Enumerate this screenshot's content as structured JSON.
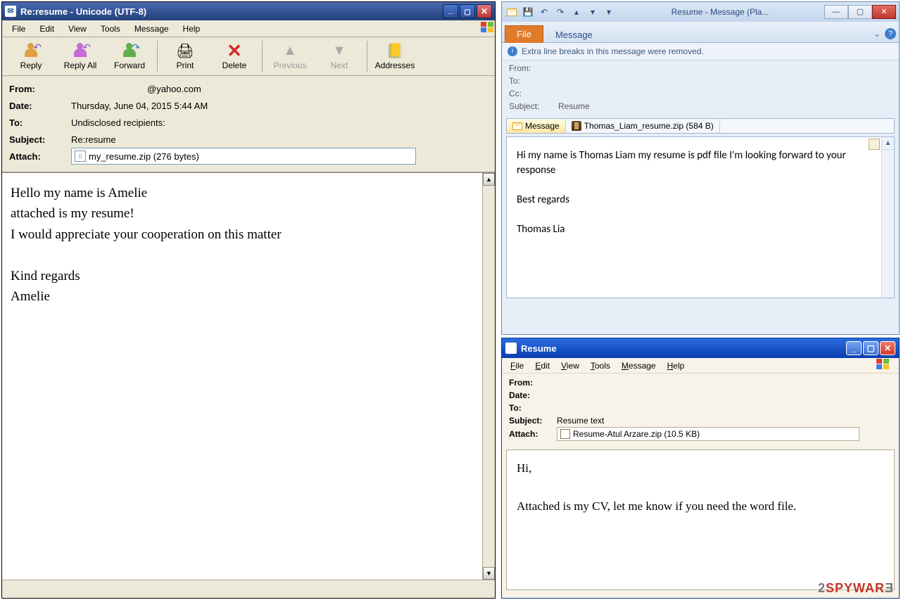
{
  "win1": {
    "title": "Re:resume - Unicode (UTF-8)",
    "menu": [
      "File",
      "Edit",
      "View",
      "Tools",
      "Message",
      "Help"
    ],
    "toolbar": {
      "reply": "Reply",
      "replyall": "Reply All",
      "forward": "Forward",
      "print": "Print",
      "delete": "Delete",
      "previous": "Previous",
      "next": "Next",
      "addresses": "Addresses"
    },
    "headers": {
      "from_lbl": "From:",
      "from": "@yahoo.com",
      "date_lbl": "Date:",
      "date": "Thursday, June 04, 2015 5:44 AM",
      "to_lbl": "To:",
      "to": "Undisclosed recipients:",
      "subj_lbl": "Subject:",
      "subj": "Re:resume",
      "attach_lbl": "Attach:",
      "attach": "my_resume.zip (276 bytes)"
    },
    "body": "Hello my name is Amelie\n attached is my resume!\nI would appreciate your cooperation on this matter\n\nKind regards\nAmelie"
  },
  "win2": {
    "title": "Resume - Message (Pla...",
    "tabs": {
      "file": "File",
      "message": "Message"
    },
    "info": "Extra line breaks in this message were removed.",
    "headers": {
      "from_lbl": "From:",
      "to_lbl": "To:",
      "cc_lbl": "Cc:",
      "subj_lbl": "Subject:",
      "subj": "Resume"
    },
    "attachtabs": {
      "msg": "Message",
      "file": "Thomas_Liam_resume.zip (584 B)"
    },
    "body": "Hi my name is Thomas Liam my resume is pdf file I'm looking forward to your response\n\nBest regards\n\nThomas Lia"
  },
  "win3": {
    "title": "Resume",
    "menu": [
      "File",
      "Edit",
      "View",
      "Tools",
      "Message",
      "Help"
    ],
    "headers": {
      "from_lbl": "From:",
      "date_lbl": "Date:",
      "to_lbl": "To:",
      "subj_lbl": "Subject:",
      "subj": "Resume text",
      "attach_lbl": "Attach:",
      "attach": "Resume-Atul Arzare.zip (10.5 KB)"
    },
    "body": "Hi,\n\nAttached is my CV, let me know if you need the word file."
  },
  "watermark": {
    "a": "2",
    "b": "SPYWAR",
    "c": "Ǝ"
  }
}
